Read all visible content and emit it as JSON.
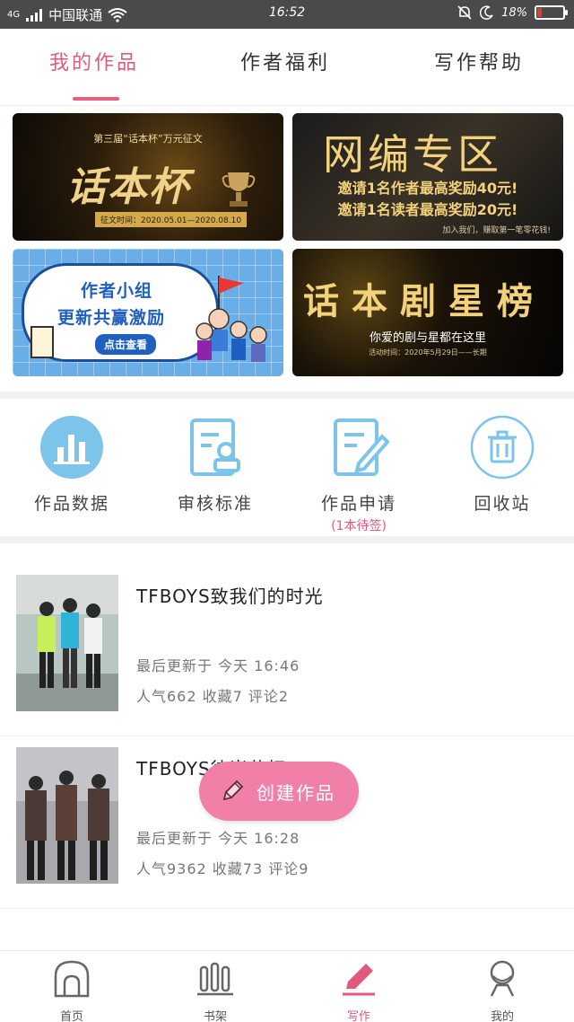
{
  "status_bar": {
    "network": "4G",
    "carrier": "中国联通",
    "time": "16:52",
    "battery": "18%",
    "battery_level": 0.18
  },
  "tabs": [
    {
      "label": "我的作品",
      "active": true
    },
    {
      "label": "作者福利",
      "active": false
    },
    {
      "label": "写作帮助",
      "active": false
    }
  ],
  "banners": {
    "b1": {
      "subtitle": "第三届“话本杯”万元征文",
      "title": "话本杯",
      "date": "征文时间：2020.05.01—2020.08.10"
    },
    "b2": {
      "title": "网编专区",
      "line1": "邀请1名作者最高奖励40元!",
      "line2": "邀请1名读者最高奖励20元!",
      "footer": "加入我们，赚取第一笔零花钱!"
    },
    "b3": {
      "line1": "作者小组",
      "line2": "更新共赢激励",
      "button": "点击查看"
    },
    "b4": {
      "title": "话本剧星榜",
      "subtitle": "你爱的剧与星都在这里",
      "footer": "活动时间：2020年5月29日——长期"
    }
  },
  "actions": [
    {
      "label": "作品数据",
      "icon": "bar-chart-icon"
    },
    {
      "label": "审核标准",
      "icon": "review-document-icon"
    },
    {
      "label": "作品申请",
      "icon": "edit-document-icon",
      "note": "(1本待签)"
    },
    {
      "label": "回收站",
      "icon": "trash-icon"
    }
  ],
  "works": [
    {
      "title": "TFBOYS致我们的时光",
      "updated": "最后更新于 今天 16:46",
      "stats": "人气662 收藏7 评论2"
    },
    {
      "title": "TFBOYS彼岸花灯",
      "updated": "最后更新于 今天 16:28",
      "stats": "人气9362 收藏73 评论9"
    }
  ],
  "fab": {
    "label": "创建作品",
    "icon": "pencil-icon"
  },
  "bottom_nav": [
    {
      "label": "首页",
      "icon": "home-icon",
      "active": false
    },
    {
      "label": "书架",
      "icon": "bookshelf-icon",
      "active": false
    },
    {
      "label": "写作",
      "icon": "pen-icon",
      "active": true
    },
    {
      "label": "我的",
      "icon": "profile-icon",
      "active": false
    }
  ],
  "colors": {
    "accent": "#e05a7c",
    "fab": "#f080a8",
    "icon_blue": "#7cc4ea",
    "statusbar": "#4a4a4a"
  }
}
